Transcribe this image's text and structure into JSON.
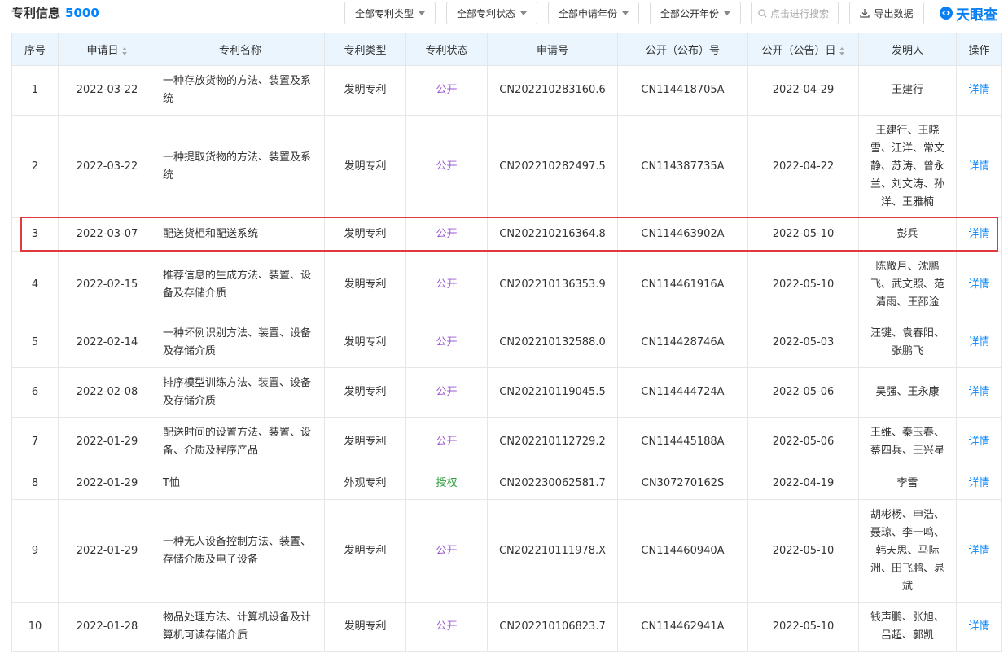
{
  "header": {
    "title": "专利信息",
    "count": "5000",
    "filters": [
      "全部专利类型",
      "全部专利状态",
      "全部申请年份",
      "全部公开年份"
    ],
    "search_placeholder": "点击进行搜索",
    "export_label": "导出数据",
    "brand": "天眼查"
  },
  "table": {
    "columns": [
      "序号",
      "申请日",
      "专利名称",
      "专利类型",
      "专利状态",
      "申请号",
      "公开（公布）号",
      "公开（公告）日",
      "发明人",
      "操作"
    ],
    "rows": [
      {
        "no": "1",
        "date": "2022-03-22",
        "name": "一种存放货物的方法、装置及系统",
        "type": "发明专利",
        "status": "公开",
        "app_no": "CN202210283160.6",
        "pub_no": "CN114418705A",
        "pub_date": "2022-04-29",
        "inventor": "王建行",
        "action": "详情"
      },
      {
        "no": "2",
        "date": "2022-03-22",
        "name": "一种提取货物的方法、装置及系统",
        "type": "发明专利",
        "status": "公开",
        "app_no": "CN202210282497.5",
        "pub_no": "CN114387735A",
        "pub_date": "2022-04-22",
        "inventor": "王建行、王晓雪、江洋、常文静、苏涛、曾永兰、刘文涛、孙洋、王雅楠",
        "action": "详情"
      },
      {
        "no": "3",
        "date": "2022-03-07",
        "name": "配送货柜和配送系统",
        "type": "发明专利",
        "status": "公开",
        "app_no": "CN202210216364.8",
        "pub_no": "CN114463902A",
        "pub_date": "2022-05-10",
        "inventor": "彭兵",
        "action": "详情"
      },
      {
        "no": "4",
        "date": "2022-02-15",
        "name": "推荐信息的生成方法、装置、设备及存储介质",
        "type": "发明专利",
        "status": "公开",
        "app_no": "CN202210136353.9",
        "pub_no": "CN114461916A",
        "pub_date": "2022-05-10",
        "inventor": "陈敞月、沈鹏飞、武文照、范清雨、王邵淦",
        "action": "详情"
      },
      {
        "no": "5",
        "date": "2022-02-14",
        "name": "一种坏例识别方法、装置、设备及存储介质",
        "type": "发明专利",
        "status": "公开",
        "app_no": "CN202210132588.0",
        "pub_no": "CN114428746A",
        "pub_date": "2022-05-03",
        "inventor": "汪键、袁春阳、张鹏飞",
        "action": "详情"
      },
      {
        "no": "6",
        "date": "2022-02-08",
        "name": "排序模型训练方法、装置、设备及存储介质",
        "type": "发明专利",
        "status": "公开",
        "app_no": "CN202210119045.5",
        "pub_no": "CN114444724A",
        "pub_date": "2022-05-06",
        "inventor": "吴强、王永康",
        "action": "详情"
      },
      {
        "no": "7",
        "date": "2022-01-29",
        "name": "配送时间的设置方法、装置、设备、介质及程序产品",
        "type": "发明专利",
        "status": "公开",
        "app_no": "CN202210112729.2",
        "pub_no": "CN114445188A",
        "pub_date": "2022-05-06",
        "inventor": "王维、秦玉春、蔡四兵、王兴星",
        "action": "详情"
      },
      {
        "no": "8",
        "date": "2022-01-29",
        "name": "T恤",
        "type": "外观专利",
        "status": "授权",
        "app_no": "CN202230062581.7",
        "pub_no": "CN307270162S",
        "pub_date": "2022-04-19",
        "inventor": "李雪",
        "action": "详情"
      },
      {
        "no": "9",
        "date": "2022-01-29",
        "name": "一种无人设备控制方法、装置、存储介质及电子设备",
        "type": "发明专利",
        "status": "公开",
        "app_no": "CN202210111978.X",
        "pub_no": "CN114460940A",
        "pub_date": "2022-05-10",
        "inventor": "胡彬杨、申浩、聂琼、李一鸣、韩天思、马际洲、田飞鹏、晁斌",
        "action": "详情"
      },
      {
        "no": "10",
        "date": "2022-01-28",
        "name": "物品处理方法、计算机设备及计算机可读存储介质",
        "type": "发明专利",
        "status": "公开",
        "app_no": "CN202210106823.7",
        "pub_no": "CN114462941A",
        "pub_date": "2022-05-10",
        "inventor": "钱声鹏、张旭、吕超、郭凯",
        "action": "详情"
      }
    ]
  }
}
